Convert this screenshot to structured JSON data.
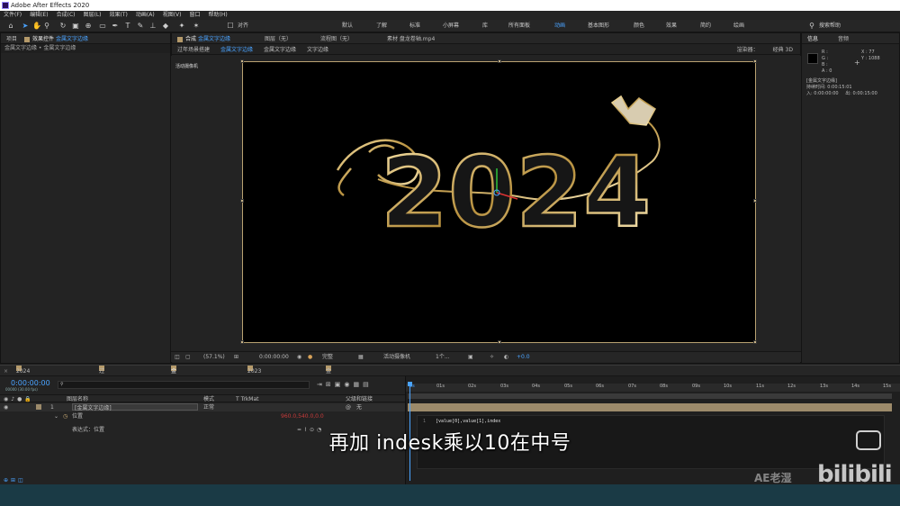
{
  "app": {
    "title": "Adobe After Effects 2020"
  },
  "menu": [
    "文件(F)",
    "编辑(E)",
    "合成(C)",
    "图层(L)",
    "效果(T)",
    "动画(A)",
    "视图(V)",
    "窗口",
    "帮助(H)"
  ],
  "toolbar": {
    "snap_label": "对齐",
    "workspaces": [
      "默认",
      "了解",
      "标准",
      "小屏幕",
      "库",
      "所有面板",
      "动画",
      "基本图形",
      "颜色",
      "效果",
      "简约",
      "绘画"
    ],
    "active_workspace": "动画",
    "search_help": "搜索帮助"
  },
  "project_panel": {
    "tab_project": "项目",
    "tab_effects": "效果控件",
    "effects_target": "金属文字边缘",
    "breadcrumb": "金属文字边缘 • 金属文字边缘"
  },
  "comp_panel": {
    "tab_comp_prefix": "合成",
    "tab_comp_name": "金属文字边缘",
    "tab_layer": "图层（无）",
    "tab_flow": "流程图（无）",
    "tab_footage": "素材 盘龙卷轴.mp4",
    "crumbs": [
      "过年场景搭建",
      "金属文字边缘",
      "金属文字边缘",
      "文字边缘"
    ],
    "renderer_label": "渲染器：",
    "renderer_value": "经典 3D",
    "camera_label": "活动摄像机",
    "artwork_text": "2024"
  },
  "viewer_bar": {
    "zoom": "(57.1%)",
    "timecode": "0:00:00:00",
    "resolution": "完整",
    "camera": "活动摄像机",
    "views": "1个...",
    "exposure": "+0.0"
  },
  "info_panel": {
    "tab_info": "信息",
    "tab_audio": "音频",
    "r_label": "R :",
    "g_label": "G :",
    "b_label": "B :",
    "a_label": "A : 0",
    "x_label": "X : 77",
    "y_label": "Y : 1088",
    "comp_name": "[金属文字边缘]",
    "duration_label": "持续时间: 0:00:15:01",
    "in_label": "入: 0:00:00:00",
    "out_label": "出: 0:00:15:00"
  },
  "timeline": {
    "tabs": [
      "2024过年文字效果",
      "过年场景搭建",
      "金属文字边缘",
      "2023文字立体化",
      "金属文字边缘"
    ],
    "active_tab": "金属文字边缘",
    "timecode": "0:00:00:00",
    "frame_info": "00000 (30.00 fps)",
    "search_placeholder": "",
    "columns": {
      "name": "图层名称",
      "mode": "模式",
      "trkmat": "T TrkMat",
      "parent": "父级和链接"
    },
    "layer": {
      "num": "1",
      "name": "[金属文字边缘]",
      "mode": "正常",
      "parent": "无"
    },
    "property": {
      "name": "位置",
      "value": "960.0,540.0,0.0"
    },
    "expression_label": "表达式：位置",
    "expression_text": "[value[0],value[1],index",
    "ruler": [
      "0s",
      "01s",
      "02s",
      "03s",
      "04s",
      "05s",
      "06s",
      "07s",
      "08s",
      "09s",
      "10s",
      "11s",
      "12s",
      "13s",
      "14s",
      "15s"
    ]
  },
  "overlay": {
    "subtitle": "再加 indesk乘以10在中号",
    "watermark": "bilibili",
    "channel": "AE老湿"
  },
  "colors": {
    "accent": "#4aa3ff",
    "gold": "#c9a96a",
    "layer_bar": "#9c8a6a"
  }
}
